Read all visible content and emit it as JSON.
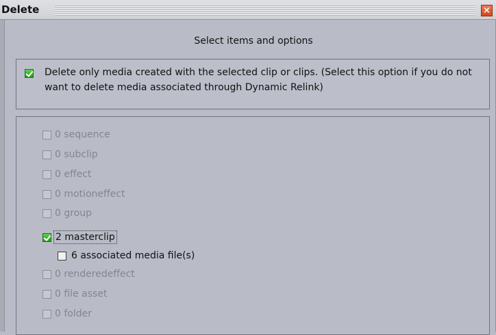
{
  "window": {
    "title": "Delete",
    "close_glyph": "×"
  },
  "heading": "Select items and options",
  "option": {
    "checked": true,
    "label": "Delete only media created with the selected clip or clips. (Select this option if you do not want to delete media associated through Dynamic Relink)"
  },
  "items": [
    {
      "label": "0 sequence",
      "checked": false,
      "enabled": false
    },
    {
      "label": "0 subclip",
      "checked": false,
      "enabled": false
    },
    {
      "label": "0 effect",
      "checked": false,
      "enabled": false
    },
    {
      "label": "0 motioneffect",
      "checked": false,
      "enabled": false
    },
    {
      "label": "0 group",
      "checked": false,
      "enabled": false
    },
    {
      "label": "2 masterclip",
      "checked": true,
      "enabled": true,
      "focused": true
    },
    {
      "label": "6 associated media file(s)",
      "checked": false,
      "enabled": true,
      "indent": true
    },
    {
      "label": "0 renderedeffect",
      "checked": false,
      "enabled": false
    },
    {
      "label": "0 file asset",
      "checked": false,
      "enabled": false
    },
    {
      "label": "0 folder",
      "checked": false,
      "enabled": false
    }
  ],
  "colors": {
    "background": "#b9bcc7",
    "checkbox_green": "#3cb630",
    "close_button": "#e05a30",
    "disabled_text": "#83858d"
  }
}
